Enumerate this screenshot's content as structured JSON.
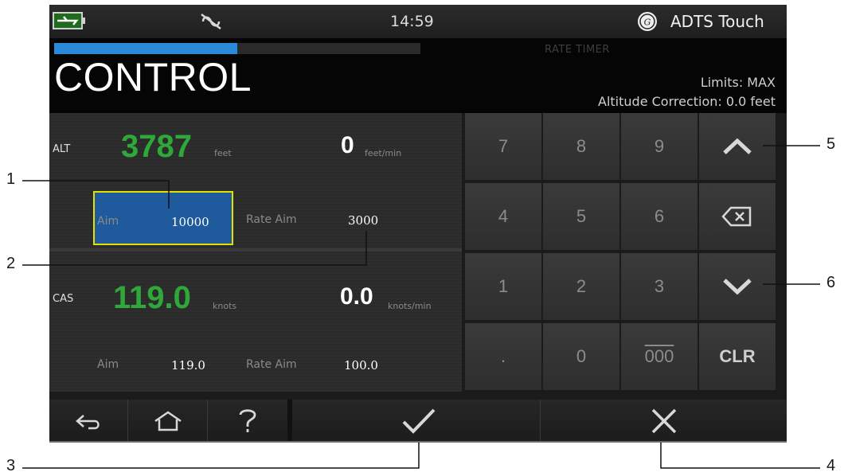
{
  "status_bar": {
    "time": "14:59",
    "device_name": "ADTS Touch",
    "battery_icon": "battery-charging-icon",
    "sync_icon": "no-sync-icon",
    "logo_icon": "ge-logo-icon"
  },
  "header": {
    "title": "CONTROL",
    "rate_timer": "RATE TIMER",
    "limits": "Limits: MAX",
    "altitude_correction": "Altitude Correction: 0.0 feet",
    "progress_fraction": 0.5,
    "progress_color": "#2c88d9"
  },
  "altitude": {
    "label": "ALT",
    "value": "3787",
    "unit": "feet",
    "rate": "0",
    "rate_unit": "feet/min",
    "aim_label": "Aim",
    "aim_value": "10000",
    "rate_aim_label": "Rate Aim",
    "rate_aim_value": "3000"
  },
  "airspeed": {
    "label": "CAS",
    "value": "119.0",
    "unit": "knots",
    "rate": "0.0",
    "rate_unit": "knots/min",
    "aim_label": "Aim",
    "aim_value": "119.0",
    "rate_aim_label": "Rate Aim",
    "rate_aim_value": "100.0"
  },
  "keypad": {
    "keys": [
      "7",
      "8",
      "9",
      "4",
      "5",
      "6",
      "1",
      "2",
      "3",
      ".",
      "0",
      "000"
    ],
    "clear": "CLR",
    "up_icon": "chevron-up-icon",
    "backspace_icon": "backspace-icon",
    "down_icon": "chevron-down-icon"
  },
  "bottom_bar": {
    "back_icon": "back-icon",
    "home_icon": "home-icon",
    "help_icon": "help-icon",
    "confirm_icon": "check-icon",
    "cancel_icon": "close-icon"
  },
  "callouts": [
    "1",
    "2",
    "3",
    "4",
    "5",
    "6"
  ],
  "colors": {
    "measured_value": "#2fa83a",
    "selected_aim": "#1e5a9c",
    "selection_border": "#e4e000"
  }
}
